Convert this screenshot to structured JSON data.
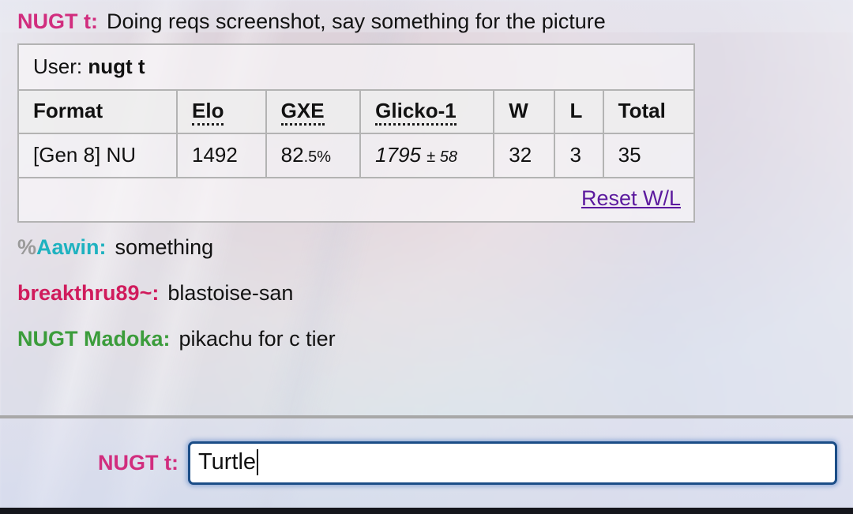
{
  "window": {
    "bottom_bar_color": "#15161c"
  },
  "chat": {
    "top_message": {
      "rank_symbol": "",
      "username": "NUGT t:",
      "username_color": "#d12d7e",
      "text": "Doing reqs screenshot, say something for the picture"
    },
    "messages": [
      {
        "rank_symbol": "%",
        "username": "Aawin:",
        "username_color": "#1fb2c0",
        "text": "something"
      },
      {
        "rank_symbol": "",
        "username": "breakthru89~:",
        "username_color": "#d01b5c",
        "text": "blastoise-san"
      },
      {
        "rank_symbol": "",
        "username": "NUGT Madoka:",
        "username_color": "#3b9c3b",
        "text": "pikachu for c tier"
      }
    ]
  },
  "ladder": {
    "user_label": "User:",
    "user_name": "nugt t",
    "columns": [
      "Format",
      "Elo",
      "GXE",
      "Glicko-1",
      "W",
      "L",
      "Total"
    ],
    "columns_dotted": [
      false,
      true,
      true,
      true,
      false,
      false,
      false
    ],
    "row": {
      "format": "[Gen 8] NU",
      "elo": "1492",
      "gxe_whole": "82",
      "gxe_frac": ".5",
      "gxe_pct": "%",
      "glicko_rating": "1795",
      "glicko_dev": "± 58",
      "wins": "32",
      "losses": "3",
      "total": "35"
    },
    "reset_link": "Reset W/L",
    "reset_link_color": "#5c1a9e"
  },
  "composer": {
    "username": "NUGT t:",
    "username_color": "#d12d7e",
    "input_value": "Turtle",
    "input_placeholder": "",
    "focus_border_color": "#1b4d87"
  }
}
